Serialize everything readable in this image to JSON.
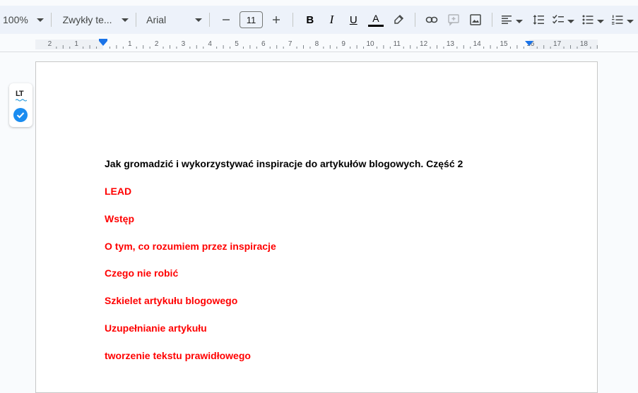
{
  "toolbar": {
    "zoom": "100%",
    "style": "Zwykły te...",
    "font": "Arial",
    "font_size": "11",
    "bold_label": "B",
    "italic_label": "I",
    "underline_label": "U",
    "text_color_label": "A",
    "text_color": "#000000"
  },
  "ruler": {
    "left_labels": [
      "2",
      "1"
    ],
    "right_labels": [
      "1",
      "2",
      "3",
      "4",
      "5",
      "6",
      "7",
      "8",
      "9",
      "10",
      "11",
      "12",
      "13",
      "14",
      "15",
      "16",
      "17",
      "18"
    ]
  },
  "languagetool": {
    "logo": "LT"
  },
  "document": {
    "title": "Jak gromadzić i wykorzystywać inspiracje do artykułów blogowych. Część 2",
    "headings": [
      "LEAD",
      "Wstęp",
      "O tym, co rozumiem przez inspiracje",
      "Czego nie robić",
      "Szkielet artykułu blogowego",
      "Uzupełnianie artykułu",
      "tworzenie tekstu prawidłowego"
    ],
    "heading_color": "#ff0000"
  }
}
